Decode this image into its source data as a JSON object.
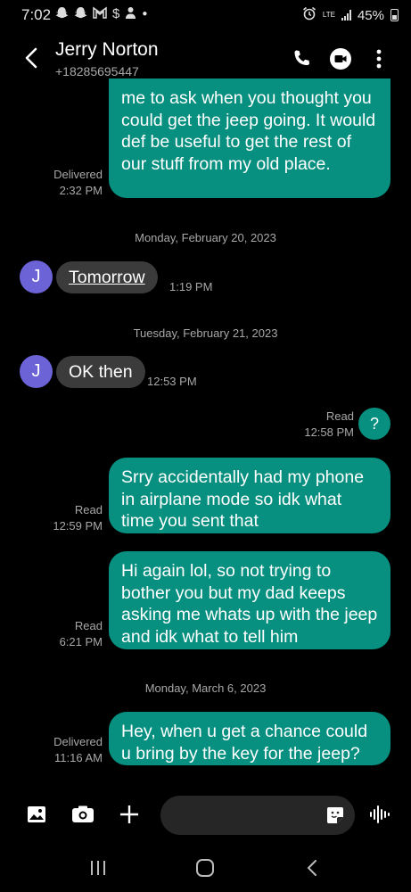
{
  "status_bar": {
    "time": "7:02",
    "left_icons": [
      "snapchat-icon",
      "snapchat-icon",
      "gmail-icon",
      "dollar-icon",
      "person-icon",
      "dot-icon"
    ],
    "right_icons": [
      "alarm-icon",
      "lte-icon",
      "signal-icon"
    ],
    "lte_label": "LTE",
    "battery": "45%"
  },
  "header": {
    "contact_name": "Jerry Norton",
    "contact_phone": "+18285695447",
    "icons": [
      "back-arrow-icon",
      "phone-icon",
      "video-call-icon",
      "more-vertical-icon"
    ]
  },
  "messages": {
    "m1": {
      "text": "me to ask when you thought you could get the jeep going. It would def be useful to get the rest of our stuff from my old place.",
      "status": "Delivered",
      "time": "2:32 PM"
    },
    "date1": "Monday, February 20, 2023",
    "m2": {
      "avatar": "J",
      "text": "Tomorrow",
      "time": "1:19 PM"
    },
    "date2": "Tuesday, February 21, 2023",
    "m3": {
      "avatar": "J",
      "text": "OK then",
      "time": "12:53 PM"
    },
    "m4": {
      "text": "?",
      "status": "Read",
      "time": "12:58 PM"
    },
    "m5": {
      "text": "Srry accidentally had my phone in airplane mode so idk what time you sent that",
      "status": "Read",
      "time": "12:59 PM"
    },
    "m6": {
      "text": "Hi again lol, so not trying to bother you but my dad keeps asking me whats up with the jeep and idk what to tell him",
      "status": "Read",
      "time": "6:21 PM"
    },
    "date3": "Monday, March 6, 2023",
    "m7": {
      "text": "Hey, when u get a chance could u bring by the key for the jeep?",
      "status": "Delivered",
      "time": "11:16 AM"
    }
  },
  "composer": {
    "placeholder": "",
    "icons": [
      "gallery-icon",
      "camera-icon",
      "add-icon",
      "sticker-icon",
      "voice-icon"
    ]
  },
  "nav_bar": {
    "icons": [
      "recent-apps-icon",
      "home-icon",
      "back-icon"
    ]
  },
  "colors": {
    "background": "#000000",
    "outgoing_bubble": "#078f80",
    "incoming_bubble": "#3b3b3b",
    "avatar": "#6b63d6",
    "secondary_text": "#a8a8a8"
  }
}
